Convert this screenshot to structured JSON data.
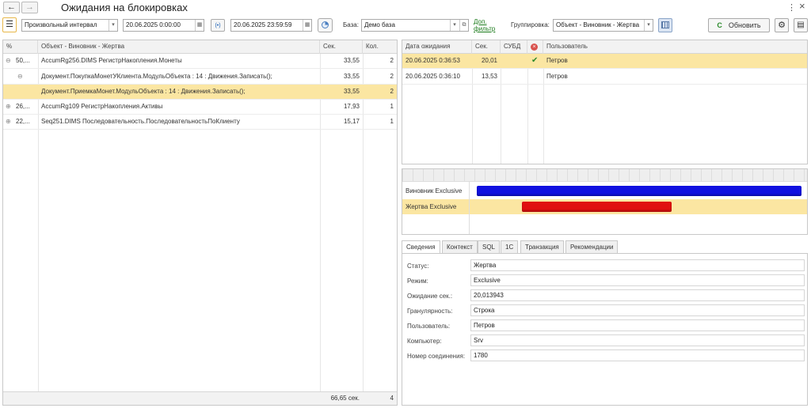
{
  "window": {
    "title": "Ожидания на блокировках",
    "back_icon": "←",
    "forward_icon": "→",
    "more_icon": "⋮",
    "close_icon": "×"
  },
  "toolbar": {
    "menu_icon": "☰",
    "interval": "Произвольный интервал",
    "date_from": "20.06.2025  0:00:00",
    "date_to": "20.06.2025 23:59:59",
    "period_btn": "(•)",
    "base_label": "База:",
    "base_value": "Демо база",
    "extra_filter_1": "Доп.",
    "extra_filter_2": "фильтр",
    "grouping_label": "Группировка:",
    "grouping_value": "Объект - Виновник - Жертва",
    "refresh_label": "Обновить",
    "refresh_icon": "C"
  },
  "left_table": {
    "headers": [
      "%",
      "Объект - Виновник - Жертва",
      "Сек.",
      "Кол."
    ],
    "rows": [
      {
        "toggle": "⊖",
        "pct": "50,...",
        "name": "AccumRg256.DIMS  РегистрНакопления.Монеты",
        "sec": "33,55",
        "cnt": "2"
      },
      {
        "toggle": "⊖",
        "pct": "",
        "name": "Документ.ПокупкаМонетУКлиента.МодульОбъекта : 14 : Движения.Записать();",
        "sec": "33,55",
        "cnt": "2"
      },
      {
        "toggle": "",
        "pct": "",
        "name": "Документ.ПриемкаМонет.МодульОбъекта : 14 : Движения.Записать();",
        "sec": "33,55",
        "cnt": "2"
      },
      {
        "toggle": "⊕",
        "pct": "26,...",
        "name": "AccumRg109  РегистрНакопления.Активы",
        "sec": "17,93",
        "cnt": "1"
      },
      {
        "toggle": "⊕",
        "pct": "22,...",
        "name": "Seq251.DIMS  Последовательность.ПоследовательностьПоКлиенту",
        "sec": "15,17",
        "cnt": "1"
      }
    ],
    "footer": {
      "sec": "66,65 сек.",
      "cnt": "4"
    }
  },
  "right_table": {
    "headers": [
      "Дата ожидания",
      "Сек.",
      "СУБД",
      "",
      "Пользователь"
    ],
    "rows": [
      {
        "date": "20.06.2025 0:36:53",
        "sec": "20,01",
        "dbms": "",
        "check": "✔",
        "user": "Петров"
      },
      {
        "date": "20.06.2025 0:36:10",
        "sec": "13,53",
        "dbms": "",
        "check": "",
        "user": "Петров"
      }
    ]
  },
  "timeline": {
    "rows": [
      {
        "label": "Виновник Exclusive",
        "color": "#1010e0",
        "start_frac": 0.0,
        "end_frac": 1.0
      },
      {
        "label": "Жертва Exclusive",
        "color": "#e01010",
        "start_frac": 0.14,
        "end_frac": 0.6
      }
    ]
  },
  "details": {
    "tabs": [
      "Сведения",
      "Контекст",
      "SQL",
      "1С",
      "Транзакция",
      "Рекомендации"
    ],
    "fields": [
      {
        "label": "Статус:",
        "value": "Жертва"
      },
      {
        "label": "Режим:",
        "value": "Exclusive"
      },
      {
        "label": "Ожидание сек.:",
        "value": "20,013943"
      },
      {
        "label": "Гранулярность:",
        "value": "Строка"
      },
      {
        "label": "Пользователь:",
        "value": "Петров"
      },
      {
        "label": "Компьютер:",
        "value": "Srv"
      },
      {
        "label": "Номер соединения:",
        "value": "1780"
      }
    ]
  },
  "colors": {
    "selection": "#fbe6a2",
    "accent": "#2b8a2b",
    "culprit": "#1010e0",
    "victim": "#e01010"
  }
}
